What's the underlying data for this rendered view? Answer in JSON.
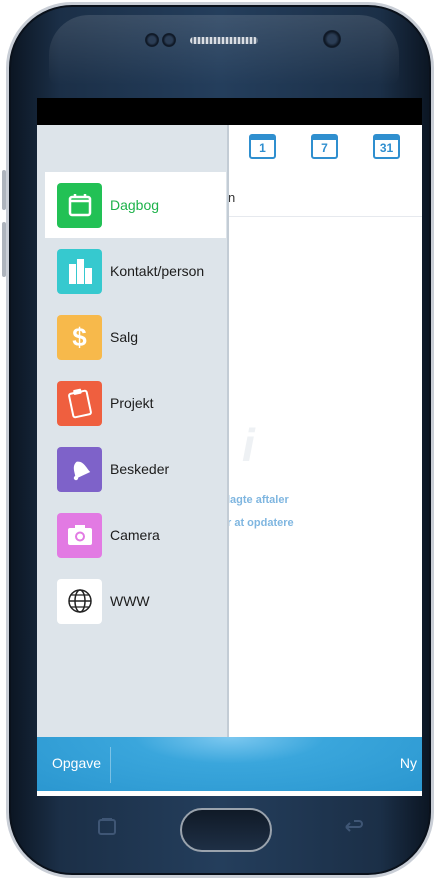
{
  "app": {
    "calendar_buttons": [
      {
        "label": "1"
      },
      {
        "label": "7"
      },
      {
        "label": "31"
      }
    ],
    "tab_overflow_text": "n",
    "empty_hint_line1": "lagte aftaler",
    "empty_hint_line2": "r at opdatere",
    "watermark_glyph": "i"
  },
  "drawer": {
    "items": [
      {
        "label": "Dagbog",
        "icon": "calendar-icon",
        "color": "#22c155",
        "active": true
      },
      {
        "label": "Kontakt/person",
        "icon": "buildings-icon",
        "color": "#36c9cf",
        "active": false
      },
      {
        "label": "Salg",
        "icon": "dollar-icon",
        "color": "#f7b94b",
        "active": false
      },
      {
        "label": "Projekt",
        "icon": "clipboard-icon",
        "color": "#ef5f3f",
        "active": false
      },
      {
        "label": "Beskeder",
        "icon": "bell-icon",
        "color": "#7e62c9",
        "active": false
      },
      {
        "label": "Camera",
        "icon": "camera-icon",
        "color": "#e27ae3",
        "active": false
      },
      {
        "label": "WWW",
        "icon": "globe-icon",
        "color": "#ffffff",
        "active": false
      }
    ]
  },
  "bottom_bar": {
    "left_label": "Opgave",
    "right_label": "Ny"
  },
  "colors": {
    "accent_blue": "#2f8fcf",
    "active_green": "#1db24a",
    "drawer_bg": "#dde4ea"
  }
}
